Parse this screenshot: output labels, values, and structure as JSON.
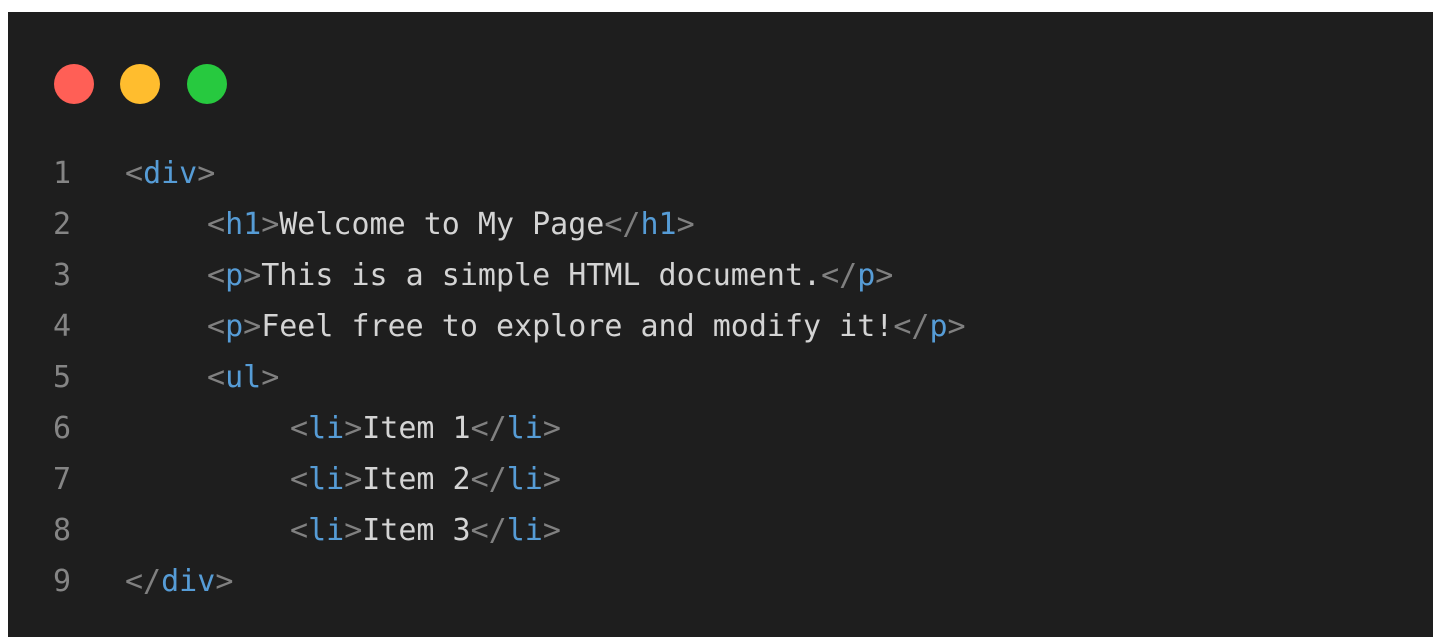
{
  "window": {
    "traffic_lights": [
      {
        "name": "close",
        "color": "#ff5f56"
      },
      {
        "name": "minimize",
        "color": "#ffbd2e"
      },
      {
        "name": "zoom",
        "color": "#27c93f"
      }
    ]
  },
  "colors": {
    "background": "#1e1e1e",
    "line_number": "#858585",
    "tag_bracket": "#808080",
    "tag_name": "#569cd6",
    "text": "#d4d4d4"
  },
  "code": {
    "lines": [
      {
        "number": "1",
        "indent": 0,
        "open": "div",
        "text": "",
        "close": ""
      },
      {
        "number": "2",
        "indent": 1,
        "open": "h1",
        "text": "Welcome to My Page",
        "close": "h1"
      },
      {
        "number": "3",
        "indent": 1,
        "open": "p",
        "text": "This is a simple HTML document.",
        "close": "p"
      },
      {
        "number": "4",
        "indent": 1,
        "open": "p",
        "text": "Feel free to explore and modify it!",
        "close": "p"
      },
      {
        "number": "5",
        "indent": 1,
        "open": "ul",
        "text": "",
        "close": ""
      },
      {
        "number": "6",
        "indent": 2,
        "open": "li",
        "text": "Item 1",
        "close": "li"
      },
      {
        "number": "7",
        "indent": 2,
        "open": "li",
        "text": "Item 2",
        "close": "li"
      },
      {
        "number": "8",
        "indent": 2,
        "open": "li",
        "text": "Item 3",
        "close": "li"
      },
      {
        "number": "9",
        "indent": 0,
        "open": "",
        "text": "",
        "close": "div"
      }
    ]
  }
}
